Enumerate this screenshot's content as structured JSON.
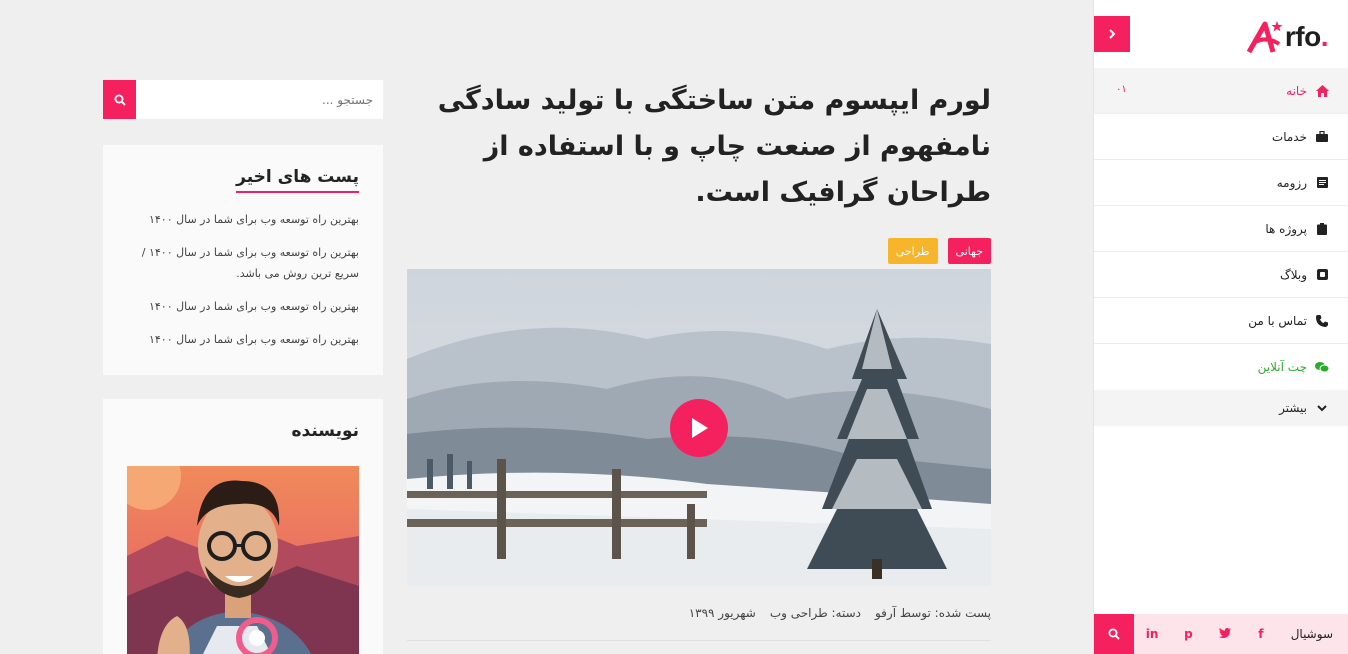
{
  "sidebar": {
    "logo_text": "rfo",
    "logo_dot": ".",
    "items": [
      {
        "label": "خانه",
        "badge": "۰۱"
      },
      {
        "label": "خدمات"
      },
      {
        "label": "رزومه"
      },
      {
        "label": "پروژه ها"
      },
      {
        "label": "وبلاگ"
      },
      {
        "label": "تماس با من"
      },
      {
        "label": "چت آنلاین"
      },
      {
        "label": "بیشتر"
      }
    ],
    "social": {
      "label": "سوشیال",
      "icons": [
        "f",
        "t",
        "p",
        "in"
      ]
    }
  },
  "article": {
    "title": "لورم ایپسوم متن ساختگی با تولید سادگی نامفهوم از صنعت چاپ و با استفاده از طراحان گرافیک است.",
    "tags": [
      "جهانی",
      "طراحی"
    ],
    "meta": {
      "posted": "پست شده: توسط آرفو",
      "category": "دسته: طراحی وب",
      "date": "شهریور ۱۳۹۹"
    }
  },
  "search": {
    "placeholder": "جستجو ..."
  },
  "recent_posts": {
    "title": "پست های اخیر",
    "items": [
      "بهترین راه توسعه وب برای شما در سال ۱۴۰۰",
      "بهترین راه توسعه وب برای شما در سال ۱۴۰۰ / سریع ترین روش می باشد.",
      "بهترین راه توسعه وب برای شما در سال ۱۴۰۰",
      "بهترین راه توسعه وب برای شما در سال ۱۴۰۰"
    ]
  },
  "author": {
    "title": "نویسنده"
  },
  "colors": {
    "accent": "#f5215e",
    "yellow": "#f6b52b",
    "green": "#2bab2e"
  }
}
